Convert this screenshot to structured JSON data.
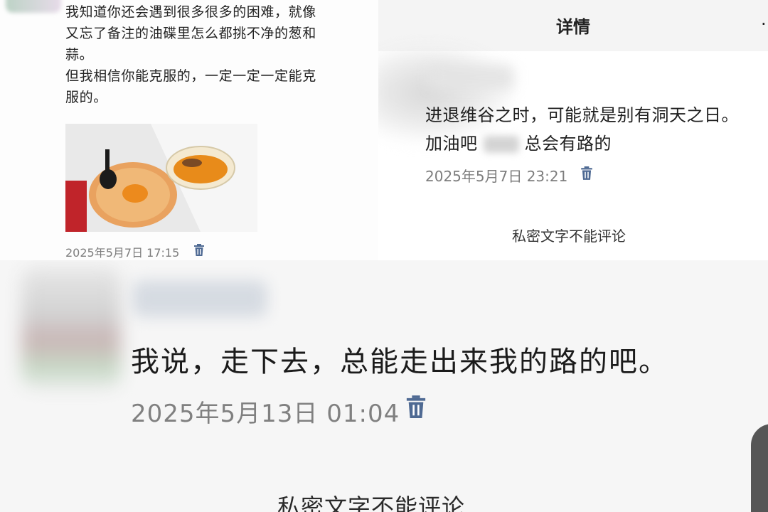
{
  "top_left": {
    "message_lines": [
      "我知道你还会遇到很多很多的困难，就像",
      "又忘了备注的油碟里怎么都挑不净的葱和",
      "蒜。",
      "但我相信你能克服的，一定一定一定能克",
      "服的。"
    ],
    "timestamp": "2025年5月7日 17:15",
    "icons": {
      "trash": "trash-icon"
    }
  },
  "top_right": {
    "header_title": "详情",
    "header_more": "·",
    "message_line1": "进退维谷之时，可能就是别有洞天之日。",
    "message_line2_prefix": "加油吧",
    "message_line2_suffix": "总会有路的",
    "timestamp": "2025年5月7日 23:21",
    "no_comment": "私密文字不能评论"
  },
  "bottom": {
    "message": "我说，走下去，总能走出来我的路的吧。",
    "timestamp": "2025年5月13日 01:04",
    "no_comment": "私密文字不能评论"
  },
  "colors": {
    "trash_icon": "#4f6a93",
    "timestamp": "#7d7d7d",
    "text": "#1f1f1f"
  }
}
